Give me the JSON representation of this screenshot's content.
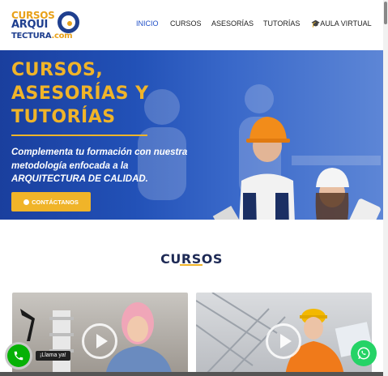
{
  "logo": {
    "line1": "CURSOS",
    "line2": "ARQUI",
    "line3_main": "TECTURA",
    "line3_suffix": ".com",
    "colors": {
      "blue": "#1f3f8f",
      "orange": "#e8a11a"
    }
  },
  "nav": {
    "items": [
      {
        "label": "INICIO",
        "active": true
      },
      {
        "label": "CURSOS"
      },
      {
        "label": "ASESORÍAS"
      },
      {
        "label": "TUTORÍAS"
      },
      {
        "label": "AULA VIRTUAL",
        "icon": "graduation-cap-icon"
      }
    ]
  },
  "hero": {
    "title": "CURSOS, ASESORÍAS Y TUTORÍAS",
    "subtitle": "Complementa tu formación con nuestra metodología enfocada a la ARQUITECTURA DE CALIDAD.",
    "cta_label": "CONTÁCTANOS",
    "cta_icon": "phone-icon",
    "accent_color": "#f0b429"
  },
  "section": {
    "title": "CURSOS"
  },
  "cards": [
    {
      "icon": "play-icon"
    },
    {
      "icon": "play-icon"
    }
  ],
  "floating": {
    "call_label": "¡Llama ya!",
    "call_icon": "phone-icon",
    "whatsapp_icon": "whatsapp-icon"
  }
}
